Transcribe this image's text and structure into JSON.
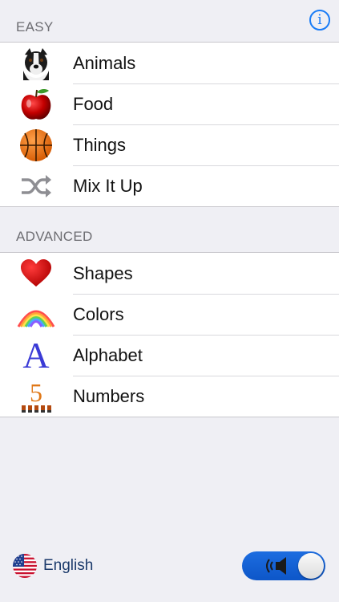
{
  "info_button": {
    "glyph": "i",
    "icon": "info-icon"
  },
  "sections": [
    {
      "header": "EASY",
      "items": [
        {
          "label": "Animals",
          "icon": "dog-icon"
        },
        {
          "label": "Food",
          "icon": "apple-icon"
        },
        {
          "label": "Things",
          "icon": "basketball-icon"
        },
        {
          "label": "Mix It Up",
          "icon": "shuffle-icon"
        }
      ]
    },
    {
      "header": "ADVANCED",
      "items": [
        {
          "label": "Shapes",
          "icon": "heart-icon"
        },
        {
          "label": "Colors",
          "icon": "rainbow-icon"
        },
        {
          "label": "Alphabet",
          "icon": "letter-a-icon",
          "glyph": "A"
        },
        {
          "label": "Numbers",
          "icon": "number-five-icon",
          "glyph": "5"
        }
      ]
    }
  ],
  "footer": {
    "language": "English",
    "flag_icon": "us-flag-icon",
    "sound_toggle": {
      "on": true,
      "icon": "speaker-icon"
    }
  },
  "colors": {
    "accent": "#1a7cf6",
    "toggle_on": "#1565d8",
    "background": "#efeff4"
  }
}
